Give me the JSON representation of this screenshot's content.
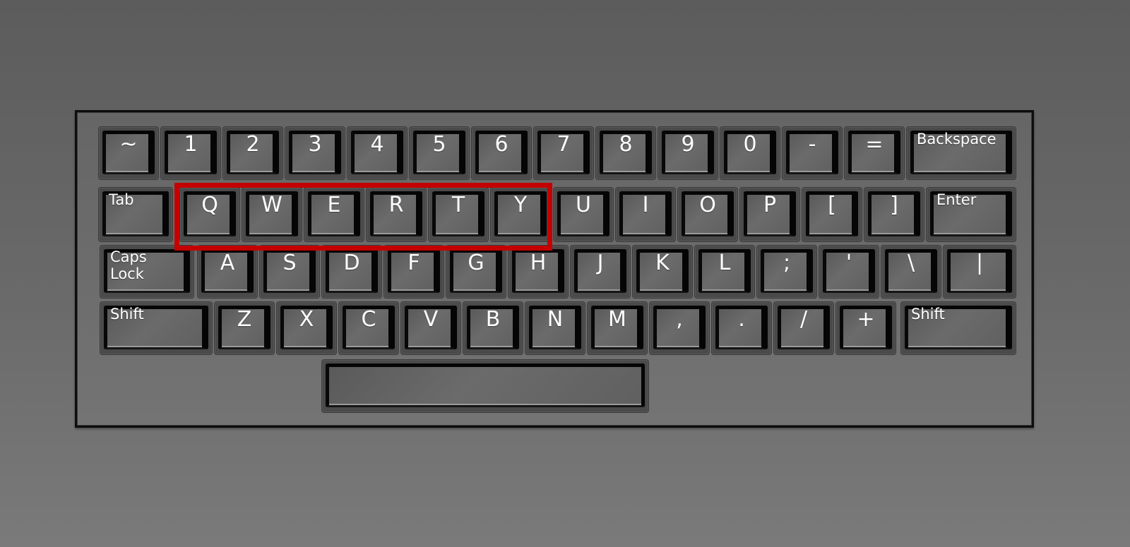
{
  "scene": "QWERTY keyboard illustration",
  "highlight": {
    "label": "QWERTY",
    "color": "#c40000",
    "keys": [
      "Q",
      "W",
      "E",
      "R",
      "T",
      "Y"
    ]
  },
  "rows": [
    {
      "name": "number-row",
      "keys": [
        "~",
        "1",
        "2",
        "3",
        "4",
        "5",
        "6",
        "7",
        "8",
        "9",
        "0",
        "-",
        "=",
        "Backspace"
      ]
    },
    {
      "name": "top-letter-row",
      "keys": [
        "Tab",
        "Q",
        "W",
        "E",
        "R",
        "T",
        "Y",
        "U",
        "I",
        "O",
        "P",
        "[",
        "]",
        "Enter"
      ]
    },
    {
      "name": "home-row",
      "keys": [
        "Caps\nLock",
        "A",
        "S",
        "D",
        "F",
        "G",
        "H",
        "J",
        "K",
        "L",
        ";",
        "'",
        "\\",
        "|"
      ]
    },
    {
      "name": "bottom-letter-row",
      "keys": [
        "Shift",
        "Z",
        "X",
        "C",
        "V",
        "B",
        "N",
        "M",
        ",",
        ".",
        "/",
        "+",
        "Shift"
      ]
    }
  ],
  "spacebar": {
    "label": ""
  }
}
